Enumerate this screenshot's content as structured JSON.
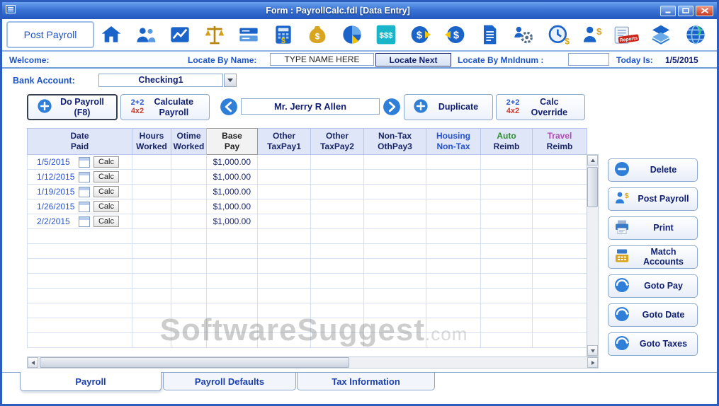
{
  "window": {
    "title": "Form : PayrollCalc.fdl [Data Entry]"
  },
  "toolbar": {
    "post_payroll_button": "Post Payroll",
    "reports_stamp_label": "Reports",
    "payroll_grid_text": "$$$",
    "icons": [
      "home-icon",
      "employees-icon",
      "chart-icon",
      "scales-icon",
      "checkbook-icon",
      "calculator-dollar-icon",
      "money-bag-icon",
      "pie-chart-dollar-icon",
      "payroll-grid-dollar-icon",
      "dollar-coin-in-icon",
      "dollar-coin-out-icon",
      "report-document-icon",
      "gear-employee-icon",
      "clock-dollar-icon",
      "worker-dollar-icon",
      "reports-stamp-icon",
      "stacked-sheets-icon",
      "globe-icon"
    ]
  },
  "locate_bar": {
    "welcome_label": "Welcome:",
    "locate_by_name_label": "Locate By Name:",
    "name_input_value": "TYPE NAME HERE",
    "locate_next_button": "Locate Next",
    "locate_by_mnidnum_label": "Locate By MnIdnum :",
    "mnidnum_input_value": "",
    "today_is_label": "Today Is:",
    "today_value": "1/5/2015"
  },
  "bank_account": {
    "label": "Bank Account:",
    "selected_value": "Checking1"
  },
  "action_bar": {
    "do_payroll_button": "Do Payroll (F8)",
    "calculate_payroll_button": "Calculate Payroll",
    "calc_icon_top": "2+2",
    "calc_icon_bottom": "4x2",
    "employee_name": "Mr. Jerry R Allen",
    "duplicate_button": "Duplicate",
    "calc_override_button": "Calc Override"
  },
  "grid": {
    "columns": [
      {
        "line1": "Date",
        "line2": "Paid"
      },
      {
        "line1": "Hours",
        "line2": "Worked"
      },
      {
        "line1": "Otime",
        "line2": "Worked"
      },
      {
        "line1": "Base",
        "line2": "Pay"
      },
      {
        "line1": "Other",
        "line2": "TaxPay1"
      },
      {
        "line1": "Other",
        "line2": "TaxPay2"
      },
      {
        "line1": "Non-Tax",
        "line2": "OthPay3"
      },
      {
        "line1": "Housing",
        "line2": "Non-Tax"
      },
      {
        "line1": "Auto",
        "line2": "Reimb"
      },
      {
        "line1": "Travel",
        "line2": "Reimb"
      }
    ],
    "calc_button_label": "Calc",
    "rows": [
      {
        "date_paid": "1/5/2015",
        "base_pay": "$1,000.00"
      },
      {
        "date_paid": "1/12/2015",
        "base_pay": "$1,000.00"
      },
      {
        "date_paid": "1/19/2015",
        "base_pay": "$1,000.00"
      },
      {
        "date_paid": "1/26/2015",
        "base_pay": "$1,000.00"
      },
      {
        "date_paid": "2/2/2015",
        "base_pay": "$1,000.00"
      }
    ],
    "empty_row_count": 8
  },
  "side_panel": {
    "buttons": [
      {
        "label": "Delete",
        "icon": "minus-circle-icon"
      },
      {
        "label": "Post Payroll",
        "icon": "person-dollar-icon"
      },
      {
        "label": "Print",
        "icon": "printer-icon"
      },
      {
        "label": "Match Accounts",
        "icon": "cash-register-icon"
      },
      {
        "label": "Goto Pay",
        "icon": "goto-sphere-icon"
      },
      {
        "label": "Goto Date",
        "icon": "goto-sphere-icon"
      },
      {
        "label": "Goto Taxes",
        "icon": "goto-sphere-icon"
      }
    ]
  },
  "tabs": [
    {
      "label": "Payroll",
      "active": true
    },
    {
      "label": "Payroll Defaults",
      "active": false
    },
    {
      "label": "Tax Information",
      "active": false
    }
  ],
  "watermark": {
    "main": "SoftwareSuggest",
    "suffix": ".com"
  },
  "colors": {
    "titlebar": "#2d62c8",
    "accent_blue": "#1c55c8",
    "navy_text": "#101f72",
    "header_bg": "#dee6f8",
    "grid_line": "#d6e0f5",
    "housing_blue": "#2453d6",
    "auto_green": "#2e8f2e",
    "travel_magenta": "#b04ab0",
    "close_red": "#c63a20"
  }
}
